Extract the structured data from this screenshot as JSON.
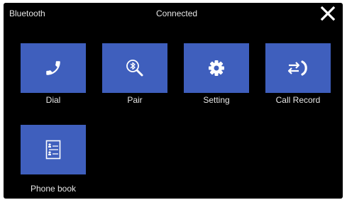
{
  "header": {
    "title": "Bluetooth",
    "status": "Connected"
  },
  "tiles": [
    {
      "label": "Dial",
      "icon": "phone-handset-icon"
    },
    {
      "label": "Pair",
      "icon": "bluetooth-search-icon"
    },
    {
      "label": "Setting",
      "icon": "gear-icon"
    },
    {
      "label": "Call Record",
      "icon": "call-transfer-icon"
    },
    {
      "label": "Phone book",
      "icon": "contact-list-icon"
    }
  ],
  "colors": {
    "background": "#000000",
    "tile": "#3f5fbd",
    "text": "#e6e6e6"
  }
}
